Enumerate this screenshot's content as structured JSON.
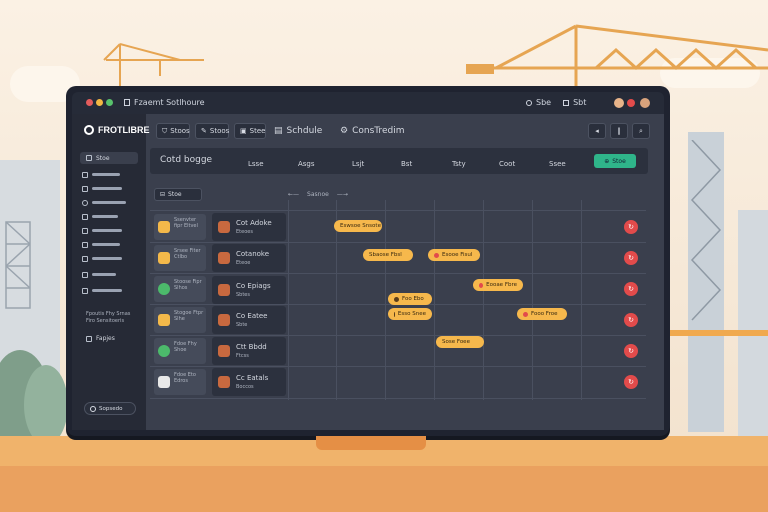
{
  "window": {
    "title": "Fzaemt Sotlhoure",
    "title_icon": "doc-icon",
    "right_labels": [
      "Sbe",
      "Sbt"
    ]
  },
  "app": {
    "logo": "FROTLIBRE"
  },
  "toolbar": {
    "buttons": [
      "Stoos",
      "Stoos",
      "Stee"
    ],
    "schedule_label": "Schdule",
    "construction_label": "ConsTredim"
  },
  "sidebar": {
    "items": [
      {
        "label": "Stoe"
      },
      {
        "label": ""
      },
      {
        "label": ""
      },
      {
        "label": ""
      },
      {
        "label": ""
      },
      {
        "label": ""
      },
      {
        "label": ""
      },
      {
        "label": ""
      },
      {
        "label": ""
      }
    ],
    "note_line1": "Fpoutis Fhy Srnas",
    "note_line2": "Firo Sensitoeris",
    "projects_label": "Fapjes",
    "footer_label": "Sopsedo"
  },
  "calendar": {
    "title": "Cotd bogge",
    "days": [
      "Lsse",
      "Asgs",
      "Lsjt",
      "Bst",
      "Tsty",
      "Coot",
      "Ssee"
    ],
    "add_button": "Stoe",
    "filter_button": "Stoe",
    "nav_label": "Sasnoe"
  },
  "rows": [
    {
      "card": "Ssenvter fipr Eltvel",
      "color": "#f4b94a",
      "task": "Cot Adoke",
      "sub": "Eteoes"
    },
    {
      "card": "Srsee Fiter Ctlbo",
      "color": "#f4b94a",
      "task": "Cotanoke",
      "sub": "Eteoe"
    },
    {
      "card": "Stoose Fipr Slhos",
      "color": "#4cba6b",
      "task": "Co Epiags",
      "sub": "Sbtes"
    },
    {
      "card": "Stogoe Ftpr Slhe",
      "color": "#f4b94a",
      "task": "Co Eatee",
      "sub": "Sbte"
    },
    {
      "card": "Fdoe Fhy Shoe",
      "color": "#4cba6b",
      "task": "Ctt Bbdd",
      "sub": "Ftcss"
    },
    {
      "card": "Fdoe Eto Edros",
      "color": "#e8e8e8",
      "task": "Cc Eatals",
      "sub": "Boccos"
    }
  ],
  "events": [
    {
      "label": "Eswsoe Snsote",
      "color": "#f6b84c"
    },
    {
      "label": "Sbaose Fbsl",
      "color": "#f6b84c"
    },
    {
      "label": "Esooe Fisul",
      "color": "#f6b84c"
    },
    {
      "label": "Eooae Fbre",
      "color": "#f6b84c"
    },
    {
      "label": "Foo Ebo",
      "color": "#f6b84c"
    },
    {
      "label": "Esso Snee",
      "color": "#f6b84c"
    },
    {
      "label": "Fooo Froe",
      "color": "#f6b84c"
    },
    {
      "label": "Sose Foee",
      "color": "#f6b84c"
    }
  ],
  "accent": "#2fb58a",
  "flag_color": "#e24b4b"
}
